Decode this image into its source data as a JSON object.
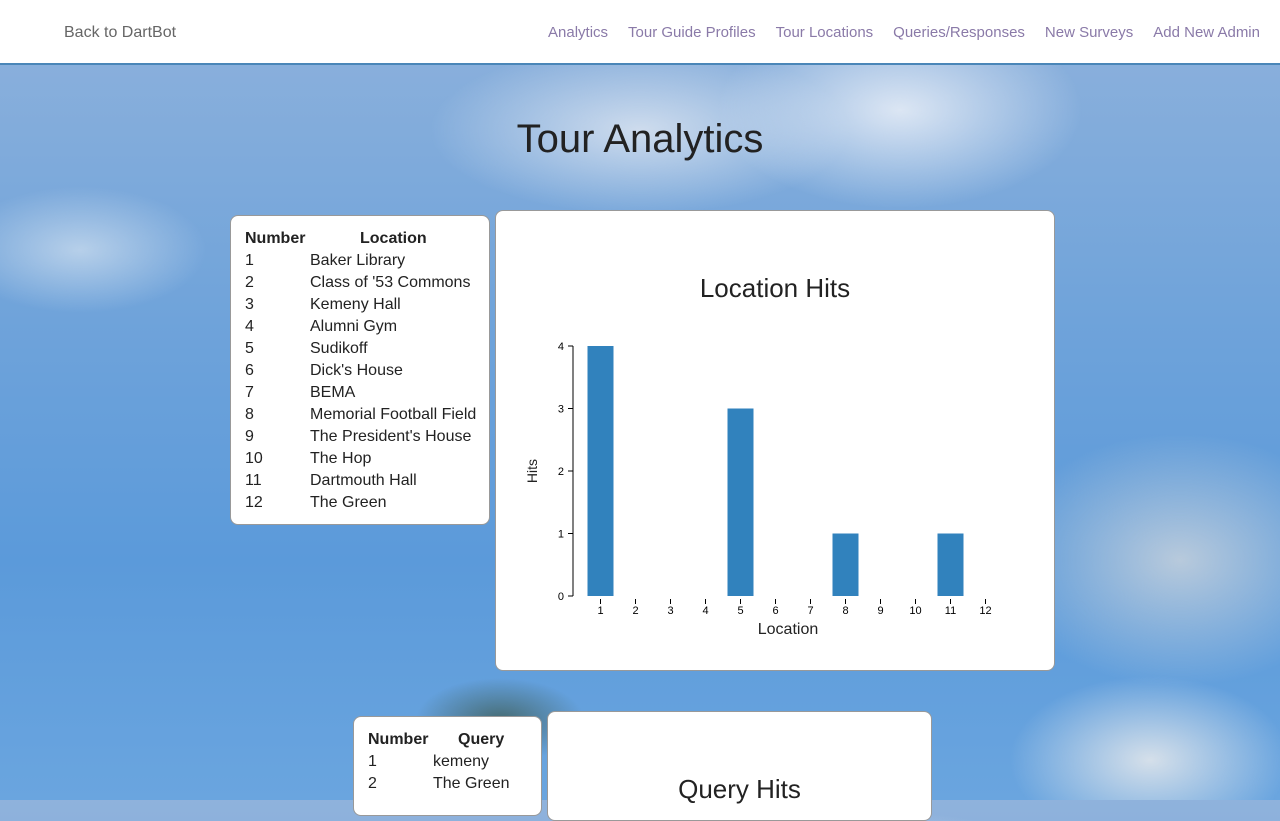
{
  "nav": {
    "brand": "Back to DartBot",
    "links": [
      "Analytics",
      "Tour Guide Profiles",
      "Tour Locations",
      "Queries/Responses",
      "New Surveys",
      "Add New Admin"
    ]
  },
  "page": {
    "title": "Tour Analytics"
  },
  "location_table": {
    "headers": [
      "Number",
      "Location"
    ],
    "rows": [
      [
        "1",
        "Baker Library"
      ],
      [
        "2",
        "Class of '53 Commons"
      ],
      [
        "3",
        "Kemeny Hall"
      ],
      [
        "4",
        "Alumni Gym"
      ],
      [
        "5",
        "Sudikoff"
      ],
      [
        "6",
        "Dick's House"
      ],
      [
        "7",
        "BEMA"
      ],
      [
        "8",
        "Memorial Football Field"
      ],
      [
        "9",
        "The President's House"
      ],
      [
        "10",
        "The Hop"
      ],
      [
        "11",
        "Dartmouth Hall"
      ],
      [
        "12",
        "The Green"
      ]
    ]
  },
  "query_table": {
    "headers": [
      "Number",
      "Query"
    ],
    "rows": [
      [
        "1",
        "kemeny"
      ],
      [
        "2",
        "The Green"
      ]
    ]
  },
  "query_chart": {
    "title": "Query Hits"
  },
  "chart_data": {
    "type": "bar",
    "title": "Location Hits",
    "xlabel": "Location",
    "ylabel": "Hits",
    "categories": [
      "1",
      "2",
      "3",
      "4",
      "5",
      "6",
      "7",
      "8",
      "9",
      "10",
      "11",
      "12"
    ],
    "values": [
      4,
      0,
      0,
      0,
      3,
      0,
      0,
      1,
      0,
      0,
      1,
      0
    ],
    "ylim": [
      0,
      4
    ],
    "yticks": [
      "0",
      "1",
      "2",
      "3",
      "4"
    ],
    "color": "#3182bd",
    "grid": false
  }
}
